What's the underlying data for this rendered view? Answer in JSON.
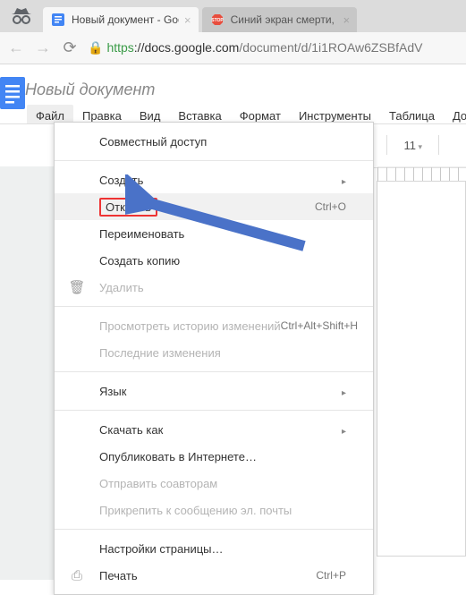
{
  "browser": {
    "tabs": [
      {
        "title": "Новый документ - Googl"
      },
      {
        "title": "Синий экран смерти, BS"
      }
    ],
    "url_https": "https",
    "url_host": "://docs.google.com",
    "url_path": "/document/d/1i1ROAw6ZSBfAdV"
  },
  "docs": {
    "title": "Новый документ",
    "menubar": [
      "Файл",
      "Правка",
      "Вид",
      "Вставка",
      "Формат",
      "Инструменты",
      "Таблица",
      "До"
    ],
    "font_size": "11"
  },
  "menu": {
    "share": "Совместный доступ",
    "create": "Создать",
    "open": "Открыть",
    "open_sc": "Ctrl+O",
    "rename": "Переименовать",
    "copy": "Создать копию",
    "delete": "Удалить",
    "history": "Просмотреть историю изменений",
    "history_sc": "Ctrl+Alt+Shift+H",
    "recent": "Последние изменения",
    "language": "Язык",
    "download": "Скачать как",
    "publish": "Опубликовать в Интернете…",
    "email_collab": "Отправить соавторам",
    "email_attach": "Прикрепить к сообщению эл. почты",
    "page_setup": "Настройки страницы…",
    "print": "Печать",
    "print_sc": "Ctrl+P"
  }
}
